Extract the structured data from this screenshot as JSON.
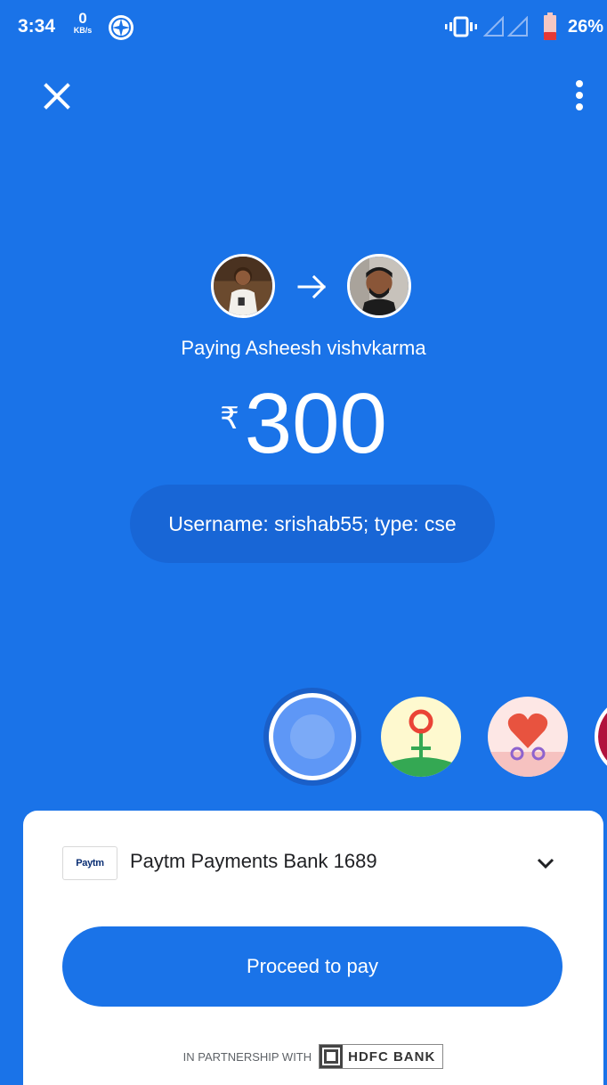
{
  "status_bar": {
    "time": "3:34",
    "net_speed": "0",
    "net_unit": "KB/s",
    "battery_percent": "26%"
  },
  "payment": {
    "paying_label": "Paying Asheesh vishvkarma",
    "currency": "₹",
    "amount": "300",
    "note": "Username: srishab55; type: cse"
  },
  "bank": {
    "logo_text": "Paytm",
    "name": "Paytm Payments Bank 1689"
  },
  "actions": {
    "proceed_label": "Proceed to pay"
  },
  "partner": {
    "label": "IN PARTNERSHIP WITH",
    "bank_logo_text": "HDFC BANK"
  },
  "colors": {
    "primary": "#1a73e8",
    "note_bg": "#1866d6",
    "sheet_bg": "#ffffff"
  },
  "icons": [
    "close-icon",
    "more-vert-icon",
    "arrow-right-icon",
    "chevron-down-icon",
    "vibrate-icon",
    "signal-icon",
    "battery-icon"
  ]
}
